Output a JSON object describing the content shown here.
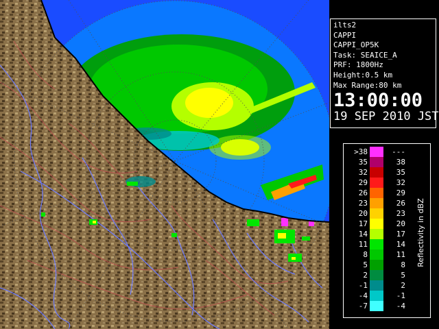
{
  "info": {
    "site": "ilts2",
    "product": "CAPPI",
    "product_code": "CAPPI_OP5K",
    "task": "Task: SEAICE_A",
    "prf": "PRF: 1800Hz",
    "height": "Height:0.5 km",
    "max_range": "Max Range:80 km",
    "time": "13:00:00",
    "date": "19 SEP 2010 JST"
  },
  "legend": {
    "unit_label": "Reflectivity in dBZ",
    "rows": [
      {
        "lo": ">38",
        "hi": "---",
        "color": "#ff30ff"
      },
      {
        "lo": "35",
        "hi": "38",
        "color": "#b0006a"
      },
      {
        "lo": "32",
        "hi": "35",
        "color": "#c80000"
      },
      {
        "lo": "29",
        "hi": "32",
        "color": "#ff1a1a"
      },
      {
        "lo": "26",
        "hi": "29",
        "color": "#ff6400"
      },
      {
        "lo": "23",
        "hi": "26",
        "color": "#ffa000"
      },
      {
        "lo": "20",
        "hi": "23",
        "color": "#ffd200"
      },
      {
        "lo": "17",
        "hi": "20",
        "color": "#ffff00"
      },
      {
        "lo": "14",
        "hi": "17",
        "color": "#b4ff00"
      },
      {
        "lo": "11",
        "hi": "14",
        "color": "#00e600"
      },
      {
        "lo": "8",
        "hi": "11",
        "color": "#00c800"
      },
      {
        "lo": "5",
        "hi": "8",
        "color": "#00a000"
      },
      {
        "lo": "2",
        "hi": "5",
        "color": "#008c40"
      },
      {
        "lo": "-1",
        "hi": "2",
        "color": "#008c8c"
      },
      {
        "lo": "-4",
        "hi": "-1",
        "color": "#00c8c8"
      },
      {
        "lo": "-7",
        "hi": "-4",
        "color": "#40ffff"
      }
    ]
  },
  "colors": {
    "sea": "#1a4cff",
    "range_area": "#0a78ff",
    "land": "#8a7048",
    "land_dark": "#5a4528",
    "coast": "#000000",
    "rivers": "#6d7cff",
    "contours": "#c05050",
    "grid": "#505050"
  }
}
